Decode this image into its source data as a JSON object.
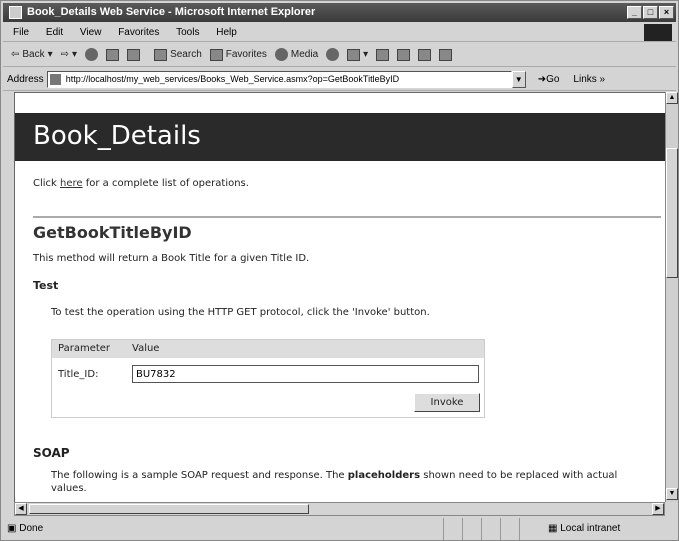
{
  "window": {
    "title": "Book_Details Web Service - Microsoft Internet Explorer"
  },
  "menu": [
    "File",
    "Edit",
    "View",
    "Favorites",
    "Tools",
    "Help"
  ],
  "toolbar": {
    "back": "Back",
    "search": "Search",
    "favorites": "Favorites",
    "media": "Media"
  },
  "address": {
    "label": "Address",
    "url": "http://localhost/my_web_services/Books_Web_Service.asmx?op=GetBookTitleByID",
    "go": "Go",
    "links": "Links"
  },
  "page": {
    "header": "Book_Details",
    "intro_before": "Click ",
    "intro_link": "here",
    "intro_after": " for a complete list of operations.",
    "operation_name": "GetBookTitleByID",
    "operation_desc": "This method will return a Book Title for a given Title ID.",
    "test_heading": "Test",
    "test_desc": "To test the operation using the HTTP GET protocol, click the 'Invoke' button.",
    "form": {
      "col_parameter": "Parameter",
      "col_value": "Value",
      "param_label": "Title_ID:",
      "param_value": "BU7832",
      "invoke_label": "Invoke"
    },
    "soap_heading": "SOAP",
    "soap_desc_before": "The following is a sample SOAP request and response. The ",
    "soap_desc_bold": "placeholders",
    "soap_desc_after": " shown need to be replaced with actual values."
  },
  "status": {
    "text": "Done",
    "zone": "Local intranet"
  }
}
